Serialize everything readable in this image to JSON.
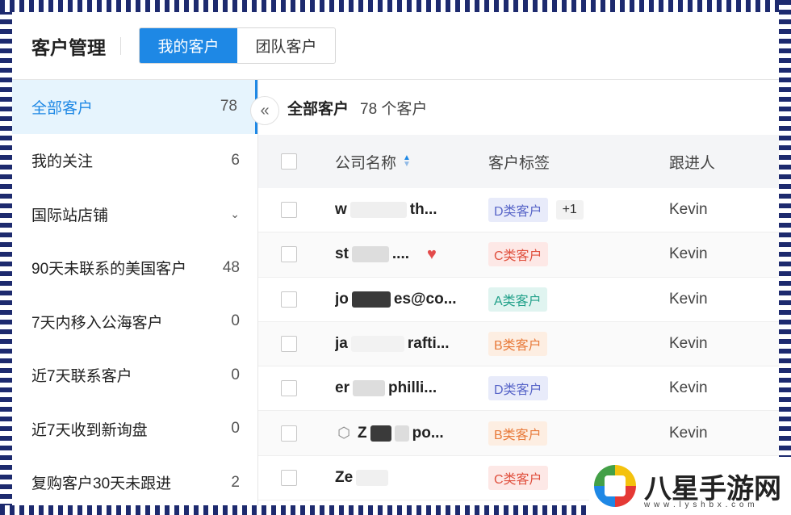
{
  "header": {
    "title": "客户管理",
    "tabs": [
      {
        "label": "我的客户",
        "active": true
      },
      {
        "label": "团队客户",
        "active": false
      }
    ]
  },
  "sidebar": {
    "items": [
      {
        "label": "全部客户",
        "count": "78",
        "active": true
      },
      {
        "label": "我的关注",
        "count": "6"
      },
      {
        "label": "国际站店铺",
        "icon": "chevron-down-icon"
      },
      {
        "label": "90天未联系的美国客户",
        "count": "48"
      },
      {
        "label": "7天内移入公海客户",
        "count": "0"
      },
      {
        "label": "近7天联系客户",
        "count": "0"
      },
      {
        "label": "近7天收到新询盘",
        "count": "0"
      },
      {
        "label": "复购客户30天未跟进",
        "count": "2"
      }
    ]
  },
  "summary": {
    "title": "全部客户",
    "count_text": "78 个客户"
  },
  "table": {
    "headers": {
      "name": "公司名称",
      "tag": "客户标签",
      "owner": "跟进人"
    },
    "rows": [
      {
        "name_start": "w",
        "name_end": "th...",
        "tag": "D类客户",
        "tag_class": "D",
        "extra": "+1",
        "owner": "Kevin"
      },
      {
        "name_start": "st",
        "name_end": "....",
        "tag": "C类客户",
        "tag_class": "C",
        "owner": "Kevin",
        "icon": "heart-icon"
      },
      {
        "name_start": "jo",
        "name_end": "es@co...",
        "tag": "A类客户",
        "tag_class": "A",
        "owner": "Kevin"
      },
      {
        "name_start": "ja",
        "name_end": "rafti...",
        "tag": "B类客户",
        "tag_class": "B",
        "owner": "Kevin"
      },
      {
        "name_start": "er",
        "name_end": "philli...",
        "tag": "D类客户",
        "tag_class": "D",
        "owner": "Kevin"
      },
      {
        "name_start": "Z",
        "name_end": "po...",
        "tag": "B类客户",
        "tag_class": "B",
        "owner": "Kevin",
        "icon": "shield-icon"
      },
      {
        "name_start": "Ze",
        "name_end": "",
        "tag": "C类客户",
        "tag_class": "C",
        "owner": ""
      }
    ]
  },
  "watermark": {
    "text": "八星手游网",
    "url": "w w w . l y s h b x . c o m"
  },
  "colors": {
    "accent": "#1e88e5",
    "frame": "#1d2a6e"
  }
}
